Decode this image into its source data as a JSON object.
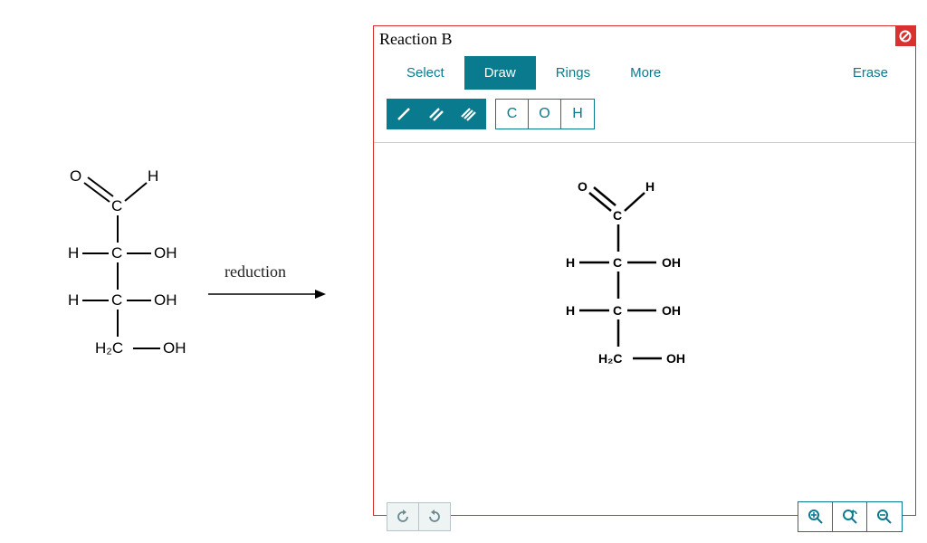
{
  "panel": {
    "title": "Reaction B"
  },
  "reaction": {
    "label": "reduction"
  },
  "toolbar": {
    "select": "Select",
    "draw": "Draw",
    "rings": "Rings",
    "more": "More",
    "erase": "Erase"
  },
  "atoms": {
    "c": "C",
    "o": "O",
    "h": "H"
  },
  "left_struct": {
    "O": "O",
    "H_top": "H",
    "C1": "C",
    "H2": "H",
    "C2": "C",
    "OH2": "OH",
    "H3": "H",
    "C3": "C",
    "OH3": "OH",
    "H2C": "H₂C",
    "OH4": "OH"
  },
  "right_struct": {
    "O": "O",
    "H_top": "H",
    "C1": "C",
    "H2": "H",
    "C2": "C",
    "OH2": "OH",
    "H3": "H",
    "C3": "C",
    "OH3": "OH",
    "H2C": "H₂C",
    "OH4": "OH"
  }
}
